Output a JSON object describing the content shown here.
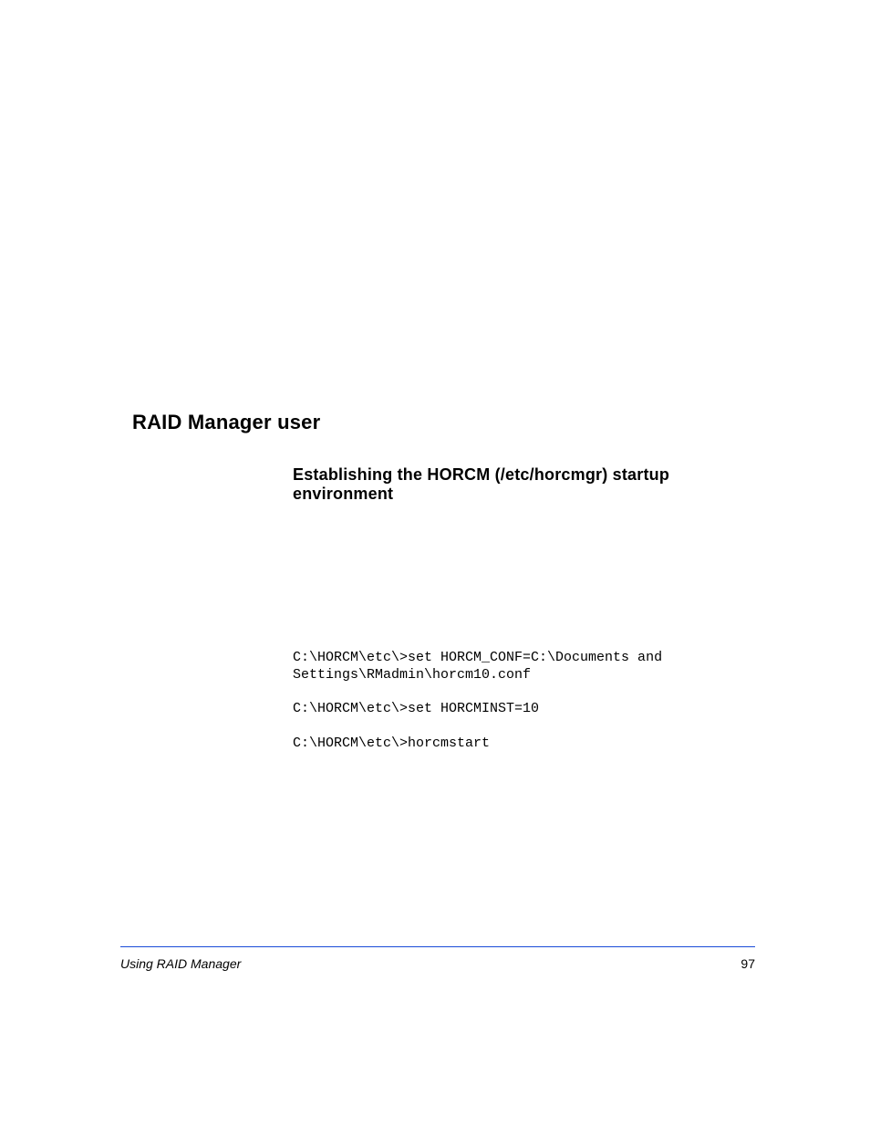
{
  "headings": {
    "h1": "RAID Manager user",
    "h2": "Establishing the HORCM (/etc/horcmgr) startup environment"
  },
  "code": {
    "line1": "C:\\HORCM\\etc\\>set HORCM_CONF=C:\\Documents and",
    "line2": "Settings\\RMadmin\\horcm10.conf",
    "line3": "C:\\HORCM\\etc\\>set HORCMINST=10",
    "line4": "C:\\HORCM\\etc\\>horcmstart"
  },
  "footer": {
    "title": "Using RAID Manager",
    "page": "97"
  }
}
